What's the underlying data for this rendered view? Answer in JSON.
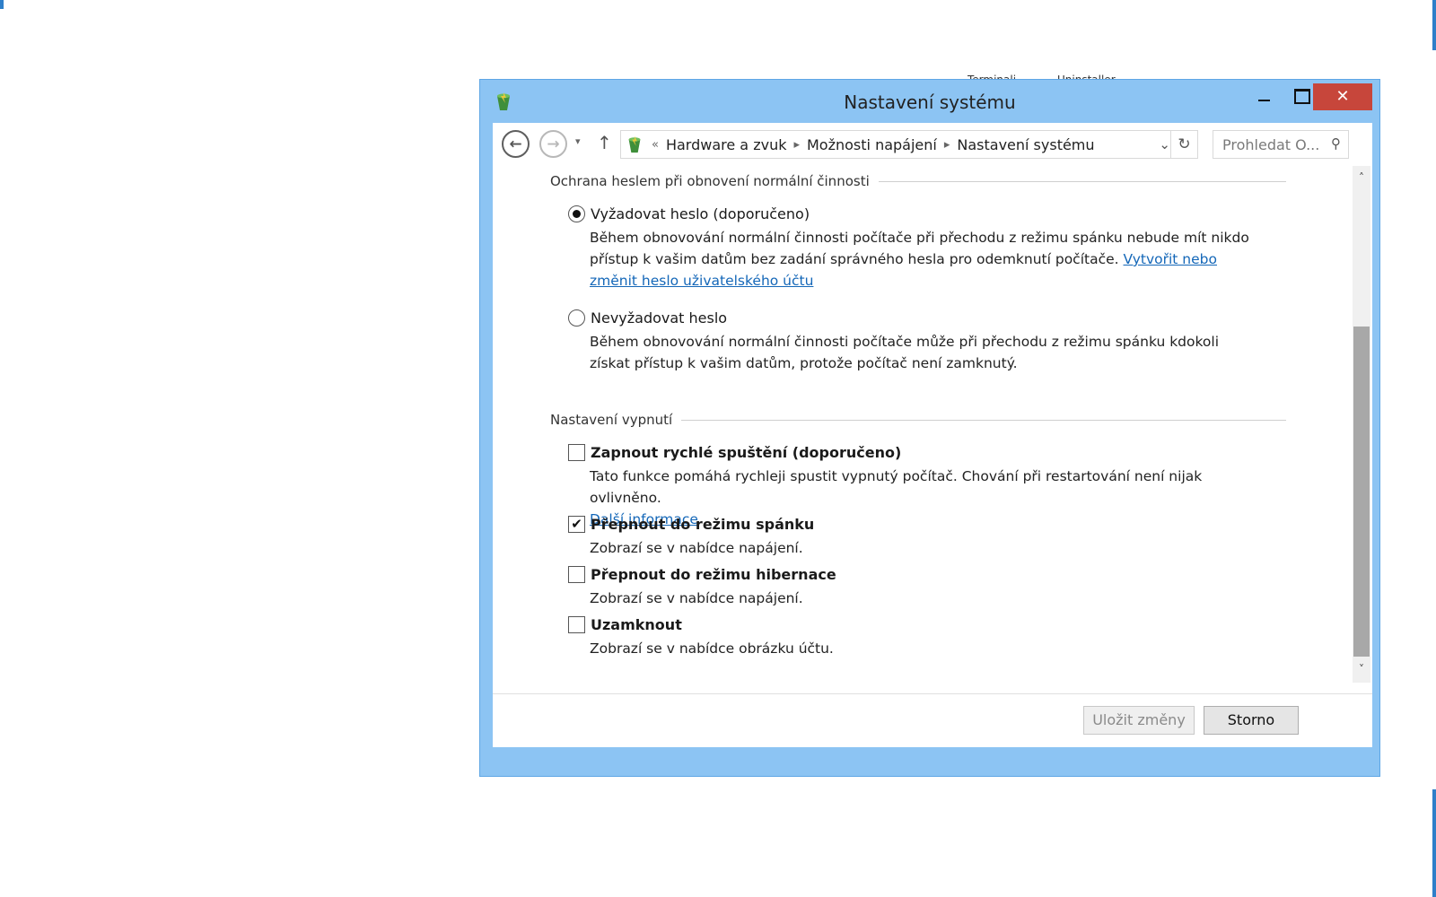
{
  "background": {
    "fragment_left": "Terminali",
    "fragment_right": "Uninstaller"
  },
  "window": {
    "title": "Nastavení systému",
    "close_glyph": "✕"
  },
  "address": {
    "back_glyph": "←",
    "forward_glyph": "→",
    "dropdown_glyph": "▾",
    "up_glyph": "↑",
    "crumb_overflow": "«",
    "breadcrumbs": [
      "Hardware a zvuk",
      "Možnosti napájení",
      "Nastavení systému"
    ],
    "separator_glyph": "▸",
    "path_dropdown_glyph": "⌄",
    "refresh_glyph": "↻",
    "search_placeholder": "Prohledat O...",
    "search_glyph": "⚲"
  },
  "password_section": {
    "heading": "Ochrana heslem při obnovení normální činnosti",
    "require": {
      "label": "Vyžadovat heslo (doporučeno)",
      "selected": true,
      "description": "Během obnovování normální činnosti počítače při přechodu z režimu spánku nebude mít nikdo přístup k vašim datům bez zadání správného hesla pro odemknutí počítače.",
      "link": "Vytvořit nebo změnit heslo uživatelského účtu"
    },
    "no_require": {
      "label": "Nevyžadovat heslo",
      "selected": false,
      "description": "Během obnovování normální činnosti počítače může při přechodu z režimu spánku kdokoli získat přístup k vašim datům, protože počítač není zamknutý."
    }
  },
  "shutdown_section": {
    "heading": "Nastavení vypnutí",
    "options": [
      {
        "label": "Zapnout rychlé spuštění (doporučeno)",
        "checked": false,
        "description": "Tato funkce pomáhá rychleji spustit vypnutý počítač. Chování při restartování není nijak ovlivněno.",
        "link": "Další informace"
      },
      {
        "label": "Přepnout do režimu spánku",
        "checked": true,
        "description": "Zobrazí se v nabídce napájení."
      },
      {
        "label": "Přepnout do režimu hibernace",
        "checked": false,
        "description": "Zobrazí se v nabídce napájení."
      },
      {
        "label": "Uzamknout",
        "checked": false,
        "description": "Zobrazí se v nabídce obrázku účtu."
      }
    ]
  },
  "scrollbar": {
    "up_glyph": "˄",
    "down_glyph": "˅"
  },
  "footer": {
    "save_label": "Uložit změny",
    "cancel_label": "Storno"
  },
  "colors": {
    "window_frame": "#8cc4f3",
    "close_button": "#c7463b",
    "link": "#1467b8"
  }
}
